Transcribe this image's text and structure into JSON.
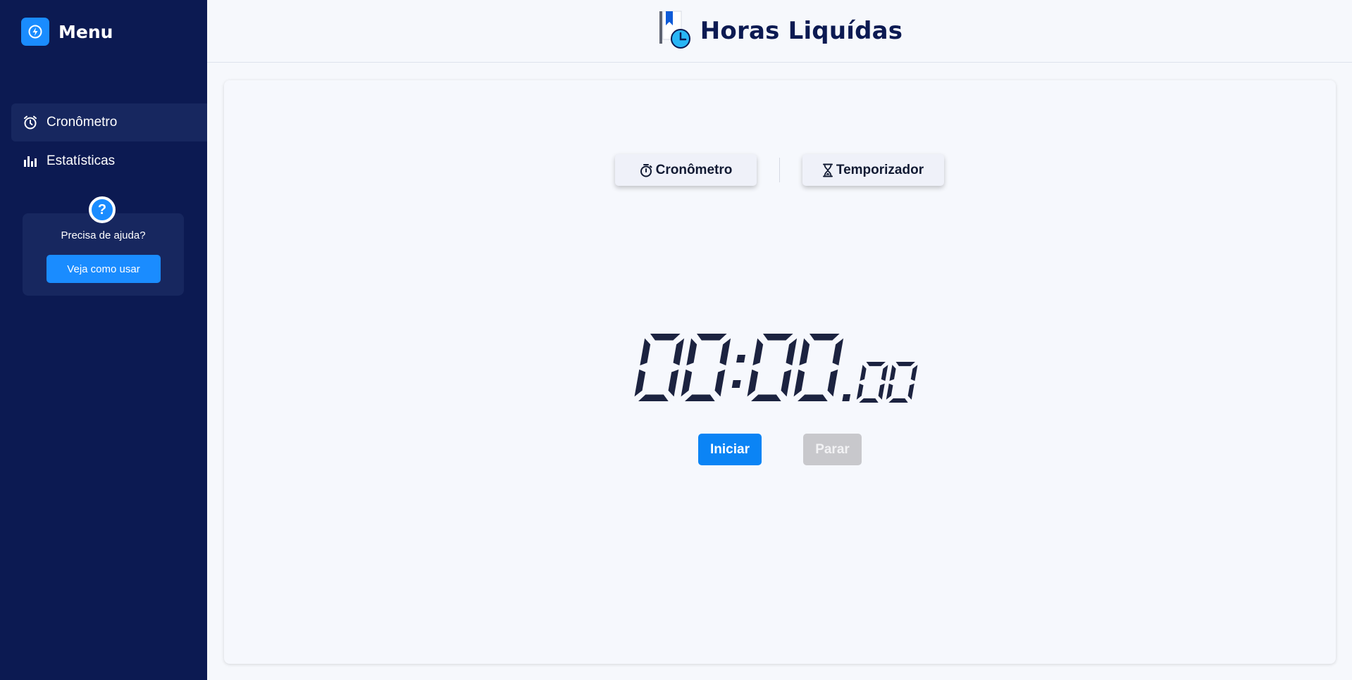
{
  "sidebar": {
    "title": "Menu",
    "logo_icon": "bolt-circle-icon",
    "items": [
      {
        "label": "Cronômetro",
        "icon": "alarm-clock-icon",
        "active": true
      },
      {
        "label": "Estatísticas",
        "icon": "bar-chart-icon",
        "active": false
      }
    ],
    "help": {
      "question": "Precisa de ajuda?",
      "badge": "?",
      "button_label": "Veja como usar"
    }
  },
  "header": {
    "title": "Horas Liquídas",
    "logo_icon": "bookmark-clock-icon"
  },
  "main": {
    "tabs": [
      {
        "label": "Cronômetro",
        "icon": "stopwatch-icon",
        "active": true
      },
      {
        "label": "Temporizador",
        "icon": "hourglass-icon",
        "active": false
      }
    ],
    "timer": {
      "minutes": "00",
      "seconds": "00",
      "hundredths": "00"
    },
    "buttons": {
      "start_label": "Iniciar",
      "stop_label": "Parar",
      "stop_disabled": true
    }
  },
  "colors": {
    "sidebar_bg": "#0c1a52",
    "accent": "#1a8cff",
    "title": "#0c1a52",
    "digits": "#1c2340",
    "disabled": "#c8c8cc"
  }
}
